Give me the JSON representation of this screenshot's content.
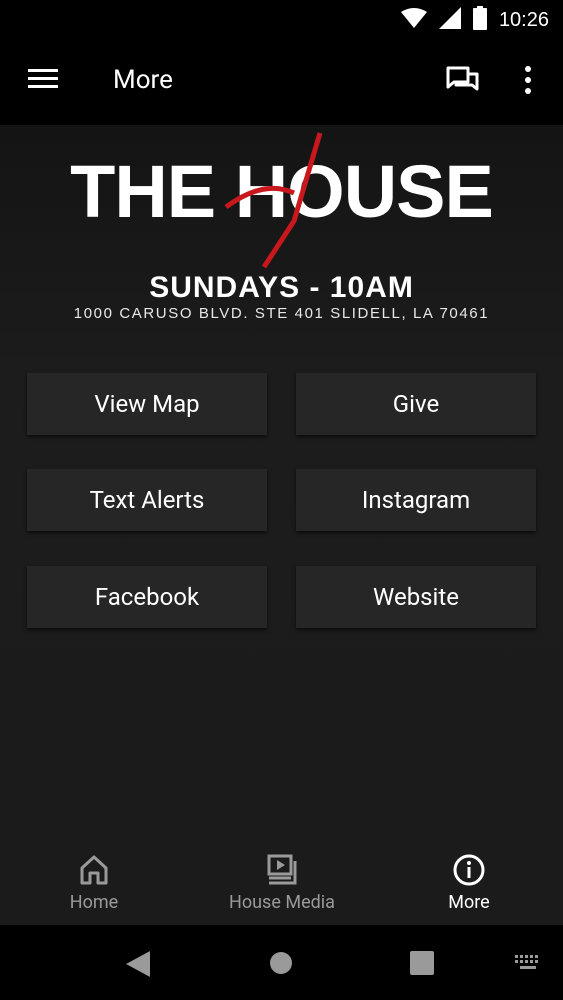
{
  "status_bar": {
    "time": "10:26",
    "icons": [
      "wifi-icon",
      "signal-icon",
      "battery-icon"
    ]
  },
  "toolbar": {
    "title": "More",
    "icons": [
      "menu-icon",
      "chat-icon",
      "more-vertical-icon"
    ]
  },
  "hero": {
    "title": "THE HOUSE",
    "service": "SUNDAYS - 10AM",
    "address": "1000 CARUSO BLVD. STE 401 SLIDELL, LA 70461",
    "accent_color": "#c8181e"
  },
  "buttons": [
    {
      "label": "View Map"
    },
    {
      "label": "Give"
    },
    {
      "label": "Text Alerts"
    },
    {
      "label": "Instagram"
    },
    {
      "label": "Facebook"
    },
    {
      "label": "Website"
    }
  ],
  "bottom_nav": [
    {
      "label": "Home",
      "icon": "home-icon",
      "active": false
    },
    {
      "label": "House Media",
      "icon": "media-icon",
      "active": false
    },
    {
      "label": "More",
      "icon": "info-icon",
      "active": true
    }
  ],
  "system_nav": [
    "back-icon",
    "home-circle-icon",
    "recents-icon",
    "keyboard-icon"
  ],
  "colors": {
    "background": "#1b1b1b",
    "button": "#262626",
    "active": "#ffffff",
    "inactive": "#9a9a9a"
  }
}
